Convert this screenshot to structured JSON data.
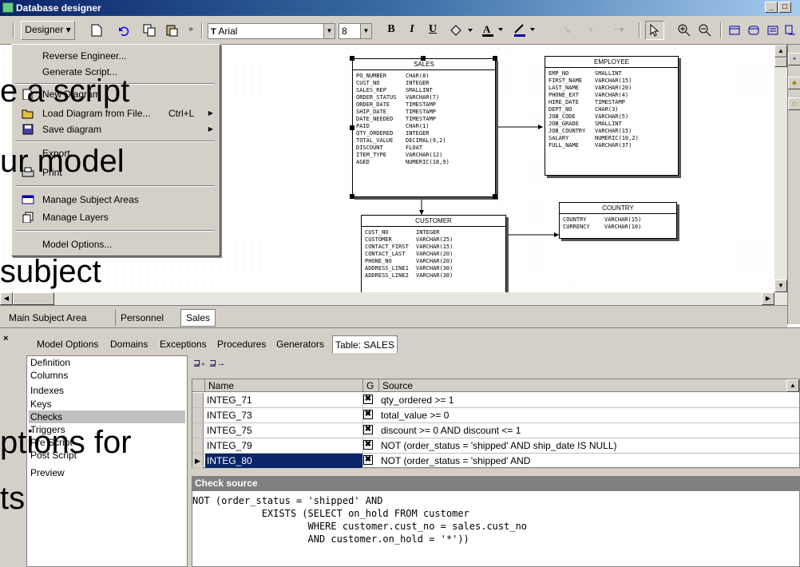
{
  "window": {
    "title": "Database designer",
    "min": "_",
    "max": "□"
  },
  "toolbar": {
    "designer_label": "Designer ▾",
    "font_name": "Arial",
    "font_size": "8",
    "bold": "B",
    "italic": "I",
    "underline": "U"
  },
  "menu": {
    "items": [
      {
        "label": "Reverse Engineer...",
        "icon": "",
        "shortcut": "",
        "submenu": false
      },
      {
        "label": "Generate Script...",
        "icon": "",
        "shortcut": "",
        "submenu": false
      },
      {
        "label": "New Diagram",
        "icon": "new-diagram-icon",
        "shortcut": "",
        "submenu": false
      },
      {
        "label": "Load Diagram from File...",
        "icon": "open-folder-icon",
        "shortcut": "Ctrl+L",
        "submenu": true
      },
      {
        "label": "Save diagram",
        "icon": "save-icon",
        "shortcut": "",
        "submenu": true
      },
      {
        "label": "Export...",
        "icon": "",
        "shortcut": "",
        "submenu": false
      },
      {
        "label": "Print",
        "icon": "print-icon",
        "shortcut": "",
        "submenu": false
      },
      {
        "label": "Manage Subject Areas",
        "icon": "subject-areas-icon",
        "shortcut": "",
        "submenu": false
      },
      {
        "label": "Manage Layers",
        "icon": "layers-icon",
        "shortcut": "",
        "submenu": false
      },
      {
        "label": "Model Options...",
        "icon": "",
        "shortcut": "",
        "submenu": false
      }
    ]
  },
  "diagram": {
    "sales": {
      "name": "SALES",
      "rows": [
        [
          "PO_NUMBER",
          "CHAR(8)"
        ],
        [
          "CUST_NO",
          "INTEGER"
        ],
        [
          "SALES_REP",
          "SMALLINT"
        ],
        [
          "ORDER_STATUS",
          "VARCHAR(7)"
        ],
        [
          "ORDER_DATE",
          "TIMESTAMP"
        ],
        [
          "SHIP_DATE",
          "TIMESTAMP"
        ],
        [
          "DATE_NEEDED",
          "TIMESTAMP"
        ],
        [
          "PAID",
          "CHAR(1)"
        ],
        [
          "QTY_ORDERED",
          "INTEGER"
        ],
        [
          "TOTAL_VALUE",
          "DECIMAL(9,2)"
        ],
        [
          "DISCOUNT",
          "FLOAT"
        ],
        [
          "ITEM_TYPE",
          "VARCHAR(12)"
        ],
        [
          "AGED",
          "NUMERIC(18,9)"
        ]
      ]
    },
    "employee": {
      "name": "EMPLOYEE",
      "rows": [
        [
          "EMP_NO",
          "SMALLINT"
        ],
        [
          "FIRST_NAME",
          "VARCHAR(15)"
        ],
        [
          "LAST_NAME",
          "VARCHAR(20)"
        ],
        [
          "PHONE_EXT",
          "VARCHAR(4)"
        ],
        [
          "HIRE_DATE",
          "TIMESTAMP"
        ],
        [
          "DEPT_NO",
          "CHAR(3)"
        ],
        [
          "JOB_CODE",
          "VARCHAR(5)"
        ],
        [
          "JOB_GRADE",
          "SMALLINT"
        ],
        [
          "JOB_COUNTRY",
          "VARCHAR(15)"
        ],
        [
          "SALARY",
          "NUMERIC(10,2)"
        ],
        [
          "FULL_NAME",
          "VARCHAR(37)"
        ]
      ]
    },
    "country": {
      "name": "COUNTRY",
      "rows": [
        [
          "COUNTRY",
          "VARCHAR(15)"
        ],
        [
          "CURRENCY",
          "VARCHAR(10)"
        ]
      ]
    },
    "customer": {
      "name": "CUSTOMER",
      "rows": [
        [
          "CUST_NO",
          "INTEGER"
        ],
        [
          "CUSTOMER",
          "VARCHAR(25)"
        ],
        [
          "CONTACT_FIRST",
          "VARCHAR(15)"
        ],
        [
          "CONTACT_LAST",
          "VARCHAR(20)"
        ],
        [
          "PHONE_NO",
          "VARCHAR(20)"
        ],
        [
          "ADDRESS_LINE1",
          "VARCHAR(30)"
        ],
        [
          "ADDRESS_LINE2",
          "VARCHAR(30)"
        ]
      ]
    }
  },
  "subject_tabs": [
    "Main Subject Area",
    "Personnel",
    "Sales"
  ],
  "panel_tabs": [
    "Model Options",
    "Domains",
    "Exceptions",
    "Procedures",
    "Generators",
    "Table: SALES"
  ],
  "panel_list": [
    "Definition",
    "Columns",
    "Indexes",
    "Keys",
    "Checks",
    "Triggers",
    "Pre Script",
    "Post Script",
    "Preview"
  ],
  "grid": {
    "headers": {
      "name": "Name",
      "g": "G",
      "source": "Source"
    },
    "rows": [
      {
        "name": "INTEG_71",
        "g": "✖",
        "source": "qty_ordered >= 1"
      },
      {
        "name": "INTEG_73",
        "g": "✖",
        "source": "total_value >= 0"
      },
      {
        "name": "INTEG_75",
        "g": "✖",
        "source": "discount >= 0 AND discount <= 1"
      },
      {
        "name": "INTEG_79",
        "g": "✖",
        "source": "NOT (order_status = 'shipped' AND ship_date IS NULL)"
      },
      {
        "name": "INTEG_80",
        "g": "✖",
        "source": "NOT (order_status = 'shipped' AND"
      }
    ]
  },
  "check_source": {
    "title": "Check source",
    "lines": [
      "NOT (order_status = 'shipped' AND",
      "            EXISTS (SELECT on_hold FROM customer",
      "                    WHERE customer.cust_no = sales.cust_no",
      "                    AND customer.on_hold = '*'))"
    ]
  },
  "overlay": {
    "line1": "e a script",
    "line2": "ur model",
    "line3": "subject",
    "line4": "ptions for",
    "line5": "ts"
  },
  "colors": {
    "selection": "#0a246a",
    "chrome": "#d4d0c8"
  }
}
